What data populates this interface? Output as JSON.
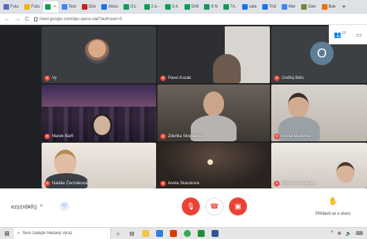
{
  "browser": {
    "tabs": [
      {
        "label": "Futu",
        "color": "#5b6abf"
      },
      {
        "label": "Futu",
        "color": "#f4b400"
      },
      {
        "label": "",
        "color": "#0f9d58",
        "active": true
      },
      {
        "label": "Test",
        "color": "#4285f4"
      },
      {
        "label": "Dov",
        "color": "#c5221f"
      },
      {
        "label": "Abso",
        "color": "#1a73e8"
      },
      {
        "label": "G1 -",
        "color": "#0f9d58"
      },
      {
        "label": "2.a -",
        "color": "#0f9d58"
      },
      {
        "label": "3.4.",
        "color": "#0f9d58"
      },
      {
        "label": "5A8",
        "color": "#0f9d58"
      },
      {
        "label": "8 N",
        "color": "#0f9d58"
      },
      {
        "label": "7A.",
        "color": "#0f9d58"
      },
      {
        "label": "sala",
        "color": "#1a73e8"
      },
      {
        "label": "Trid",
        "color": "#1a73e8"
      },
      {
        "label": "Mer",
        "color": "#4285f4"
      },
      {
        "label": "Gen",
        "color": "#6d8b3a"
      },
      {
        "label": "Bak",
        "color": "#e8710a"
      }
    ],
    "new_tab": "+",
    "back": "←",
    "forward": "→",
    "reload": "C",
    "url": "meet.google.com/dpu-qwca-oqd?authuser=0"
  },
  "side_panel": {
    "people_icon": "people-icon",
    "people_count": "13",
    "chat_icon": "chat-icon"
  },
  "participants": [
    {
      "name": "Vy",
      "muted": true
    },
    {
      "name": "Pavel Kozák",
      "muted": true
    },
    {
      "name": "Ondřej Bělo",
      "muted": true,
      "initial": "O"
    },
    {
      "name": "Marek Barfi",
      "muted": true
    },
    {
      "name": "Zdeňka Skopalová",
      "muted": true
    },
    {
      "name": "Aneta Mačková",
      "muted": true
    },
    {
      "name": "Natálie Čermáková",
      "muted": true
    },
    {
      "name": "Aneta Skácelová",
      "muted": true
    },
    {
      "name": "Eliška Čermáková",
      "muted": true
    }
  ],
  "controls": {
    "meeting_code": "ezyzxbkfcj",
    "chevron": "^",
    "mic_icon": "mic-off-icon",
    "hangup_icon": "hangup-icon",
    "camera_icon": "camera-off-icon",
    "present_label": "Přihlásit se o slovo",
    "colors": {
      "red": "#ea4335",
      "blue": "#1a73e8"
    }
  },
  "taskbar": {
    "search_placeholder": "Sem zadejte hledaný výraz",
    "tray": [
      "^",
      "⊕",
      "🔈",
      "⌨"
    ]
  }
}
